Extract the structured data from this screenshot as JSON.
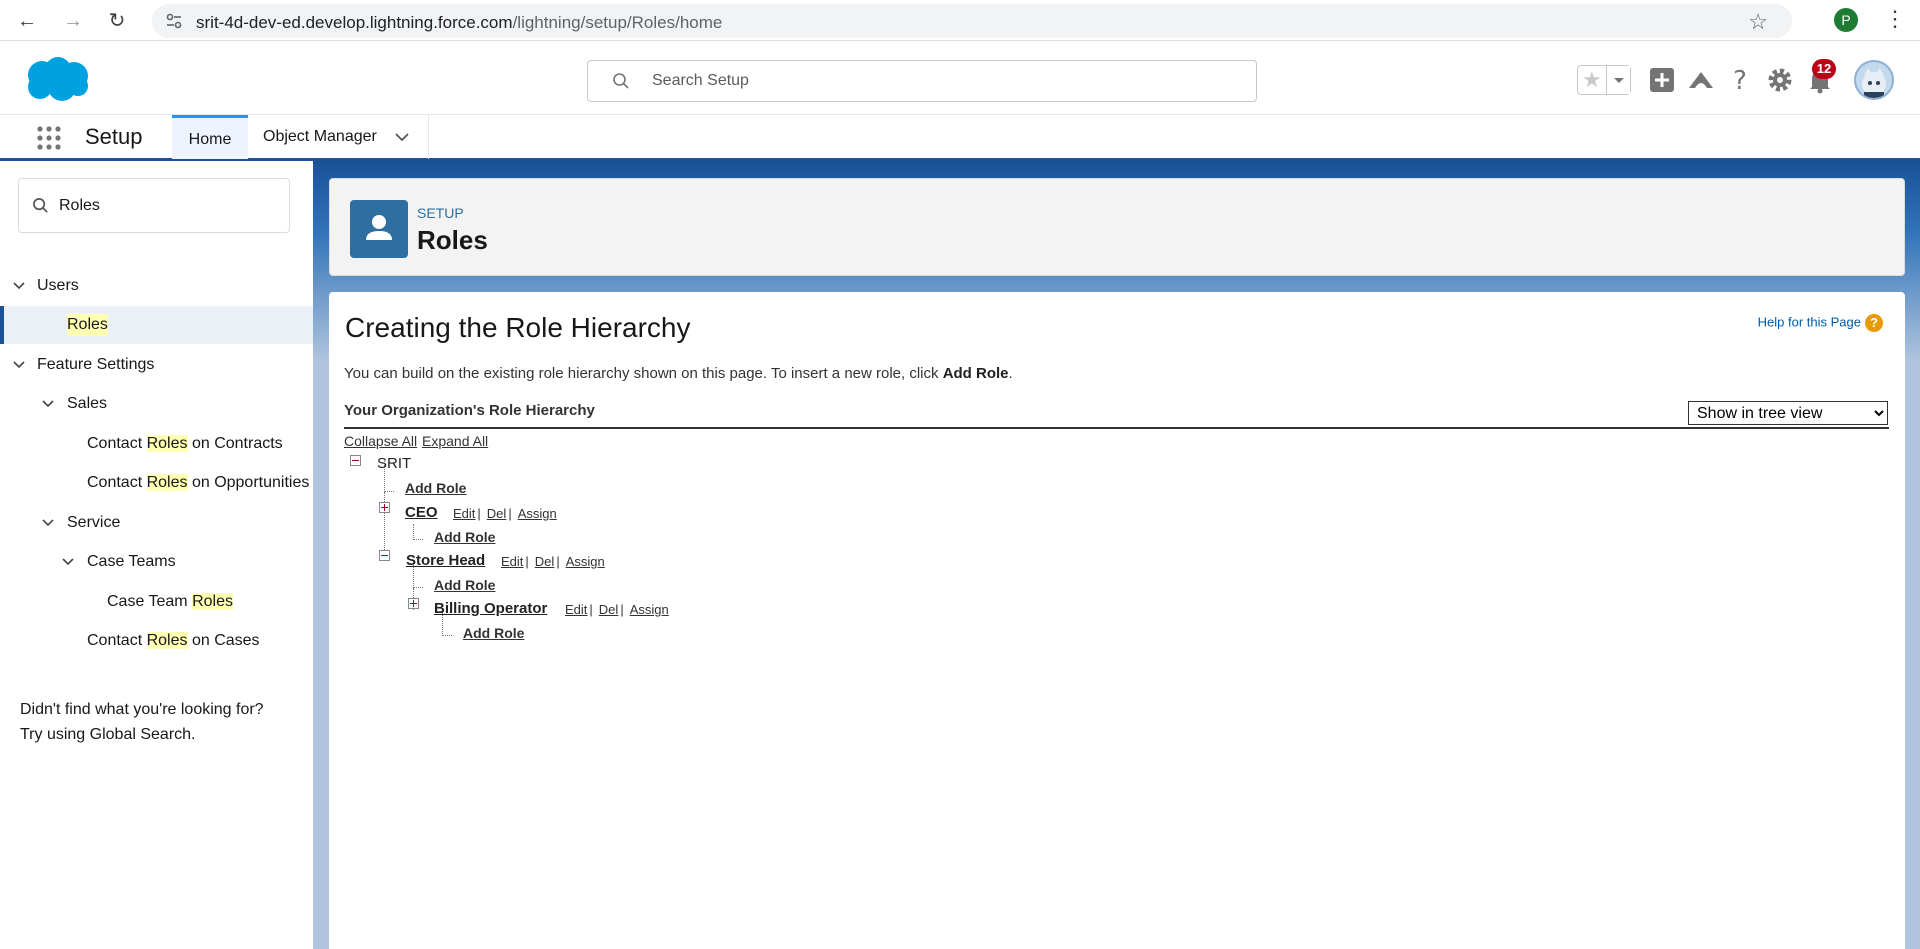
{
  "browser": {
    "url_host": "srit-4d-dev-ed.develop.lightning.force.com",
    "url_path": "/lightning/setup/Roles/home",
    "profile_initial": "P"
  },
  "header": {
    "search_placeholder": "Search Setup",
    "notification_count": "12"
  },
  "context_nav": {
    "app_name": "Setup",
    "tabs": [
      {
        "label": "Home"
      },
      {
        "label": "Object Manager"
      }
    ]
  },
  "sidebar": {
    "quick_find_value": "Roles",
    "items": [
      {
        "label": "Users"
      },
      {
        "label": "Roles"
      },
      {
        "label": "Feature Settings"
      },
      {
        "label": "Sales"
      },
      {
        "prefix": "Contact ",
        "match": "Roles",
        "suffix": " on Contracts"
      },
      {
        "prefix": "Contact ",
        "match": "Roles",
        "suffix": " on Opportunities"
      },
      {
        "label": "Service"
      },
      {
        "label": "Case Teams"
      },
      {
        "prefix": "Case Team ",
        "match": "Roles",
        "suffix": ""
      },
      {
        "prefix": "Contact ",
        "match": "Roles",
        "suffix": " on Cases"
      }
    ],
    "help_line1": "Didn't find what you're looking for?",
    "help_line2": "Try using Global Search."
  },
  "page_header": {
    "eyebrow": "SETUP",
    "title": "Roles"
  },
  "main": {
    "title": "Creating the Role Hierarchy",
    "help_link": "Help for this Page",
    "intro_text": "You can build on the existing role hierarchy shown on this page. To insert a new role, click ",
    "intro_bold": "Add Role",
    "intro_end": ".",
    "hierarchy_title": "Your Organization's Role Hierarchy",
    "view_options": [
      "Show in tree view"
    ],
    "collapse_all": "Collapse All",
    "expand_all": "Expand All",
    "root": "SRIT",
    "add_role": "Add Role",
    "edit": "Edit",
    "del": "Del",
    "assign": "Assign",
    "roles": [
      {
        "name": "CEO"
      },
      {
        "name": "Store Head"
      },
      {
        "name": "Billing Operator"
      }
    ]
  }
}
